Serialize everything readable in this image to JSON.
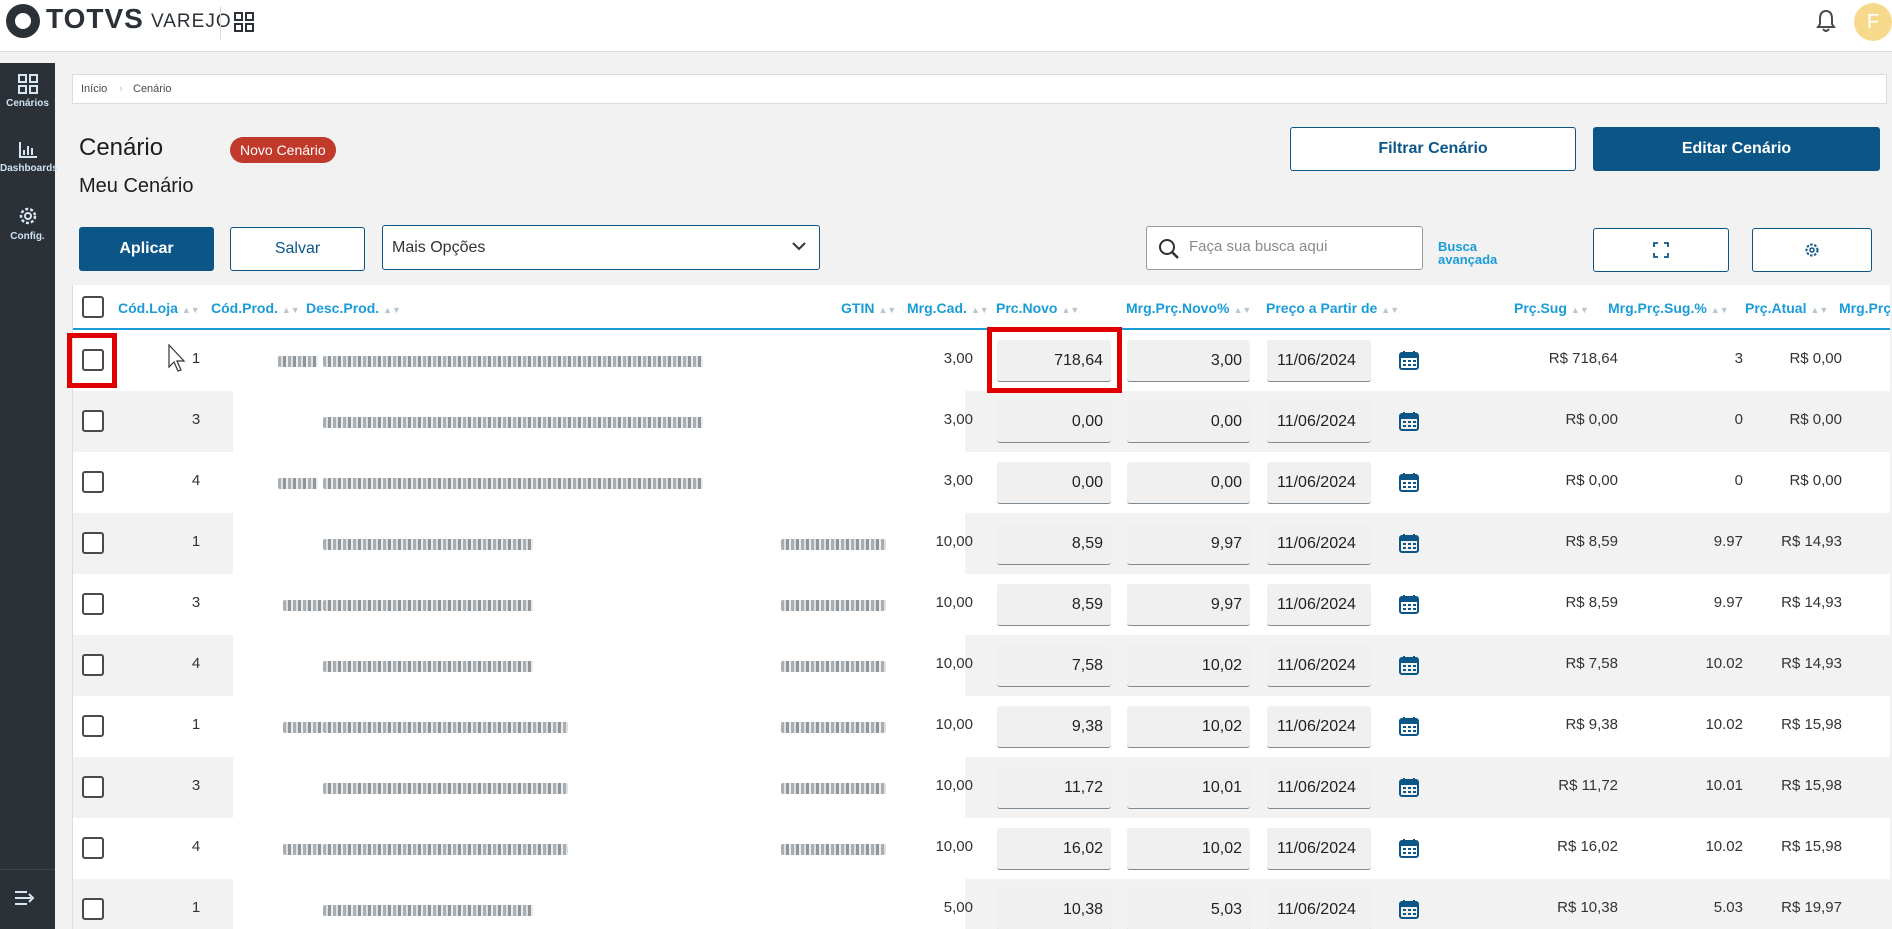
{
  "app": {
    "brand": "TOTVS",
    "product": "VAREJO",
    "avatar_initial": "F"
  },
  "sidebar": {
    "items": [
      {
        "label": "Cenários",
        "icon": "grid-icon"
      },
      {
        "label": "Dashboards",
        "icon": "bar-chart-icon"
      },
      {
        "label": "Config.",
        "icon": "gear-icon"
      }
    ],
    "collapse_icon": "expand-menu-icon"
  },
  "breadcrumb": [
    "Início",
    "Cenário"
  ],
  "header": {
    "title": "Cenário",
    "subtitle": "Meu Cenário",
    "badge": "Novo Cenário",
    "filter_button": "Filtrar Cenário",
    "edit_button": "Editar Cenário"
  },
  "toolbar": {
    "apply_button": "Aplicar",
    "save_button": "Salvar",
    "more_options": "Mais Opções",
    "search_placeholder": "Faça sua busca aqui",
    "advanced_search": "Busca avançada"
  },
  "colors": {
    "primary": "#0b5687",
    "accent": "#1a9cd8",
    "badge": "#c0392b",
    "sidebar": "#2b3136",
    "highlight": "#e00000"
  },
  "table": {
    "columns": [
      "Cód.Loja",
      "Cód.Prod.",
      "Desc.Prod.",
      "GTIN",
      "Mrg.Cad.",
      "Prc.Novo",
      "Mrg.Prç.Novo%",
      "Preço a Partir de",
      "Prç.Sug",
      "Mrg.Prç.Sug.%",
      "Prç.Atual",
      "Mrg.Prç"
    ],
    "rows": [
      {
        "loja": "1",
        "mrg_cad": "3,00",
        "prc_novo": "718,64",
        "mrg_novo": "3,00",
        "data": "11/06/2024",
        "prc_sug": "R$ 718,64",
        "mrg_sug": "3",
        "prc_atual": "R$ 0,00"
      },
      {
        "loja": "3",
        "mrg_cad": "3,00",
        "prc_novo": "0,00",
        "mrg_novo": "0,00",
        "data": "11/06/2024",
        "prc_sug": "R$ 0,00",
        "mrg_sug": "0",
        "prc_atual": "R$ 0,00"
      },
      {
        "loja": "4",
        "mrg_cad": "3,00",
        "prc_novo": "0,00",
        "mrg_novo": "0,00",
        "data": "11/06/2024",
        "prc_sug": "R$ 0,00",
        "mrg_sug": "0",
        "prc_atual": "R$ 0,00"
      },
      {
        "loja": "1",
        "mrg_cad": "10,00",
        "prc_novo": "8,59",
        "mrg_novo": "9,97",
        "data": "11/06/2024",
        "prc_sug": "R$ 8,59",
        "mrg_sug": "9.97",
        "prc_atual": "R$ 14,93"
      },
      {
        "loja": "3",
        "mrg_cad": "10,00",
        "prc_novo": "8,59",
        "mrg_novo": "9,97",
        "data": "11/06/2024",
        "prc_sug": "R$ 8,59",
        "mrg_sug": "9.97",
        "prc_atual": "R$ 14,93"
      },
      {
        "loja": "4",
        "mrg_cad": "10,00",
        "prc_novo": "7,58",
        "mrg_novo": "10,02",
        "data": "11/06/2024",
        "prc_sug": "R$ 7,58",
        "mrg_sug": "10.02",
        "prc_atual": "R$ 14,93"
      },
      {
        "loja": "1",
        "mrg_cad": "10,00",
        "prc_novo": "9,38",
        "mrg_novo": "10,02",
        "data": "11/06/2024",
        "prc_sug": "R$ 9,38",
        "mrg_sug": "10.02",
        "prc_atual": "R$ 15,98"
      },
      {
        "loja": "3",
        "mrg_cad": "10,00",
        "prc_novo": "11,72",
        "mrg_novo": "10,01",
        "data": "11/06/2024",
        "prc_sug": "R$ 11,72",
        "mrg_sug": "10.01",
        "prc_atual": "R$ 15,98"
      },
      {
        "loja": "4",
        "mrg_cad": "10,00",
        "prc_novo": "16,02",
        "mrg_novo": "10,02",
        "data": "11/06/2024",
        "prc_sug": "R$ 16,02",
        "mrg_sug": "10.02",
        "prc_atual": "R$ 15,98"
      },
      {
        "loja": "1",
        "mrg_cad": "5,00",
        "prc_novo": "10,38",
        "mrg_novo": "5,03",
        "data": "11/06/2024",
        "prc_sug": "R$ 10,38",
        "mrg_sug": "5.03",
        "prc_atual": "R$ 19,97"
      }
    ]
  }
}
